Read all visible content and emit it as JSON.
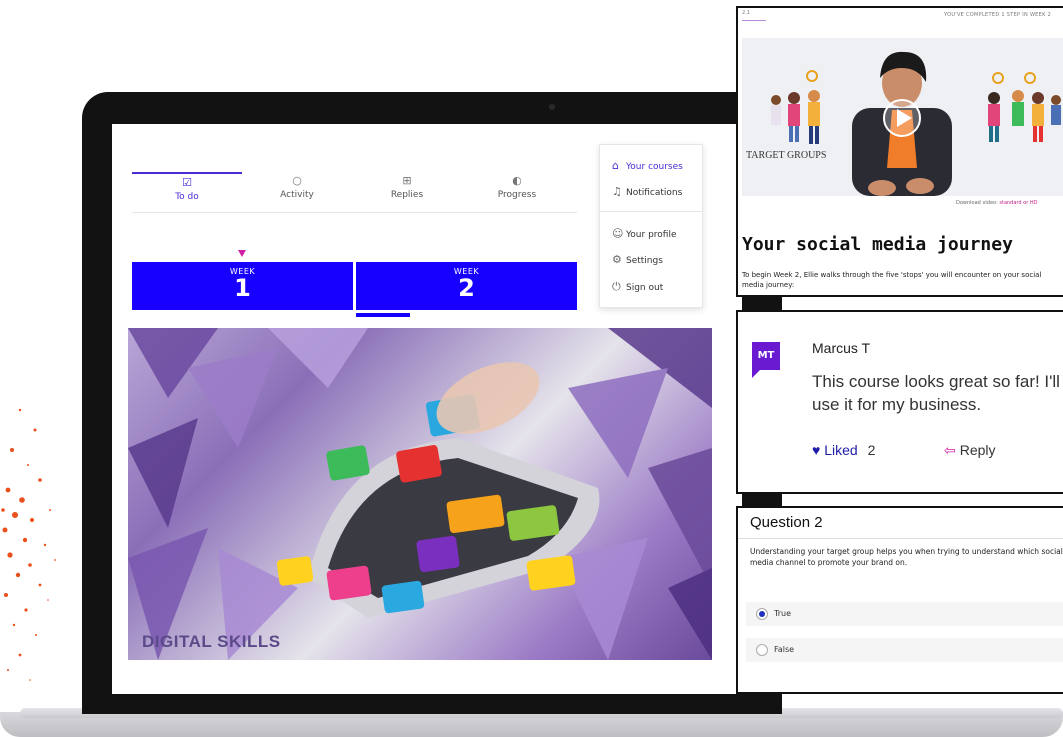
{
  "tabs": [
    {
      "label": "To do",
      "icon": "checkbox-icon"
    },
    {
      "label": "Activity",
      "icon": "circle-icon"
    },
    {
      "label": "Replies",
      "icon": "reply-box-icon"
    },
    {
      "label": "Progress",
      "icon": "progress-icon"
    }
  ],
  "weeks": [
    {
      "label": "WEEK",
      "number": "1"
    },
    {
      "label": "WEEK",
      "number": "2"
    }
  ],
  "menu": {
    "your_courses": "Your courses",
    "notifications": "Notifications",
    "your_profile": "Your profile",
    "settings": "Settings",
    "sign_out": "Sign out"
  },
  "hero": {
    "title": "DIGITAL SKILLS"
  },
  "video_card": {
    "step": "2.1",
    "completed": "YOU'VE COMPLETED 1 STEP IN WEEK 2",
    "video_label": "TARGET GROUPS",
    "download_prefix": "Download video: ",
    "download_links": "standard or HD",
    "title": "Your social media journey",
    "text": "To begin Week 2, Ellie walks through the five 'stops' you will encounter on your social media journey:"
  },
  "comment": {
    "avatar": "MT",
    "name": "Marcus T",
    "text": "This course looks great so far! I'll use it for my business.",
    "liked_label": "Liked",
    "liked_count": "2",
    "reply_label": "Reply"
  },
  "question": {
    "title": "Question 2",
    "text": "Understanding your target group helps you when trying to understand which social media channel to promote your brand on.",
    "options": [
      {
        "label": "True",
        "selected": true
      },
      {
        "label": "False",
        "selected": false
      }
    ]
  },
  "colors": {
    "week_blue": "#1700ff",
    "accent_purple": "#4c2bd6",
    "avatar_purple": "#6a1bd1",
    "marker_magenta": "#d11ea6"
  }
}
